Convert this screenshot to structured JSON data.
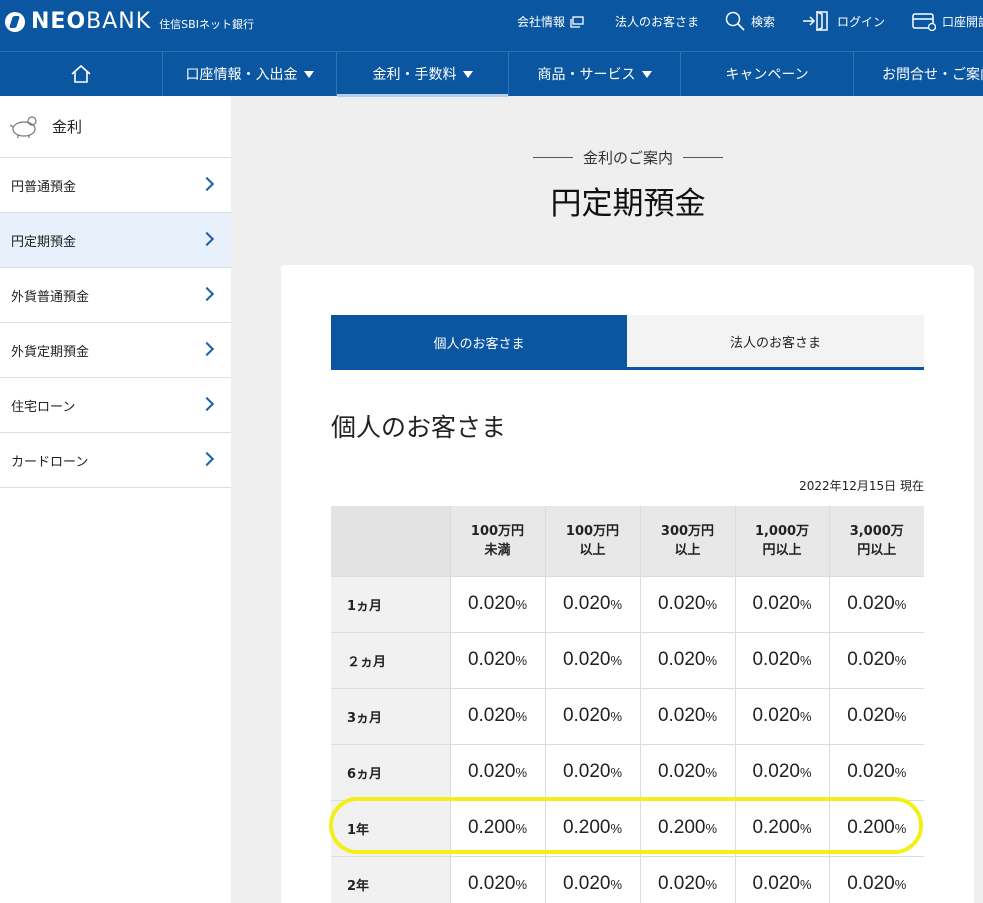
{
  "header": {
    "logo_neo": "NEO",
    "logo_bank": "BANK",
    "logo_sub": "住信SBIネット銀行",
    "utility": [
      {
        "label": "会社情報",
        "icon": "external-window-icon"
      },
      {
        "label": "法人のお客さま"
      },
      {
        "label": "検索",
        "icon": "search-icon"
      },
      {
        "label": "ログイン",
        "icon": "login-icon"
      },
      {
        "label": "口座開設",
        "icon": "card-icon"
      }
    ]
  },
  "nav": {
    "home_icon": "home-icon",
    "items": [
      {
        "label": "口座情報・入出金",
        "dropdown": true
      },
      {
        "label": "金利・手数料",
        "dropdown": true,
        "active": true
      },
      {
        "label": "商品・サービス",
        "dropdown": true
      },
      {
        "label": "キャンペーン"
      },
      {
        "label": "お問合せ・ご案内"
      }
    ]
  },
  "sidebar": {
    "heading": "金利",
    "heading_icon": "piggy-bank-icon",
    "items": [
      {
        "label": "円普通預金"
      },
      {
        "label": "円定期預金",
        "active": true
      },
      {
        "label": "外貨普通預金"
      },
      {
        "label": "外貨定期預金"
      },
      {
        "label": "住宅ローン"
      },
      {
        "label": "カードローン"
      }
    ]
  },
  "main": {
    "eyebrow": "金利のご案内",
    "title": "円定期預金",
    "tabs": [
      {
        "label": "個人のお客さま",
        "active": true
      },
      {
        "label": "法人のお客さま"
      }
    ],
    "section_title": "個人のお客さま",
    "as_of": "2022年12月15日 現在",
    "rate_table": {
      "columns": [
        {
          "line1": "100万円",
          "line2": "未満"
        },
        {
          "line1": "100万円",
          "line2": "以上"
        },
        {
          "line1": "300万円",
          "line2": "以上"
        },
        {
          "line1": "1,000万",
          "line2": "円以上"
        },
        {
          "line1": "3,000万",
          "line2": "円以上"
        }
      ],
      "percent_sign": "%",
      "rows": [
        {
          "term": "1ヵ月",
          "rates": [
            "0.020",
            "0.020",
            "0.020",
            "0.020",
            "0.020"
          ]
        },
        {
          "term": "２ヵ月",
          "rates": [
            "0.020",
            "0.020",
            "0.020",
            "0.020",
            "0.020"
          ]
        },
        {
          "term": "3ヵ月",
          "rates": [
            "0.020",
            "0.020",
            "0.020",
            "0.020",
            "0.020"
          ]
        },
        {
          "term": "6ヵ月",
          "rates": [
            "0.020",
            "0.020",
            "0.020",
            "0.020",
            "0.020"
          ]
        },
        {
          "term": "1年",
          "rates": [
            "0.200",
            "0.200",
            "0.200",
            "0.200",
            "0.200"
          ],
          "highlighted": true
        },
        {
          "term": "2年",
          "rates": [
            "0.020",
            "0.020",
            "0.020",
            "0.020",
            "0.020"
          ]
        }
      ]
    },
    "highlight_color": "#f2ef19"
  },
  "colors": {
    "brand": "#0a56a0",
    "sidebar_active": "#e8f1fb"
  }
}
